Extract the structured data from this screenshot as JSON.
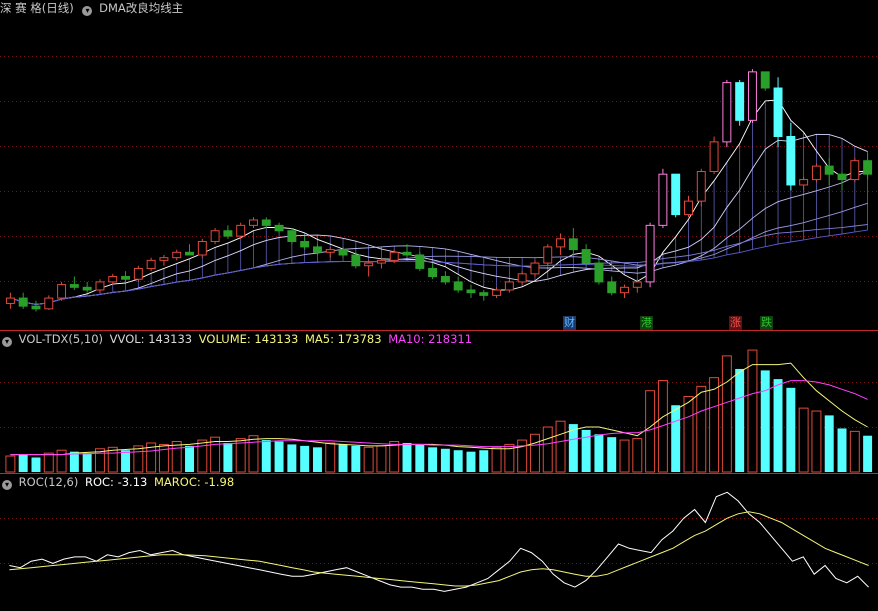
{
  "header": {
    "stock_name": "深 赛 格(日线)",
    "indicator_name": "DMA改良均线主",
    "icon": "chevron-down-icon"
  },
  "volume_header": {
    "indicator": "VOL-TDX(5,10)",
    "vvol_label": "VVOL: 143133",
    "volume_label": "VOLUME: 143133",
    "ma5_label": "MA5: 173783",
    "ma10_label": "MA10: 218311"
  },
  "roc_header": {
    "indicator": "ROC(12,6)",
    "roc_label": "ROC: -3.13",
    "maroc_label": "MAROC: -1.98"
  },
  "event_tags": [
    {
      "label": "财",
      "color": "#5fb8ff"
    },
    {
      "label": "港",
      "color": "#29c229"
    },
    {
      "label": "涨",
      "color": "#ff4a4a"
    },
    {
      "label": "跌",
      "color": "#29c229"
    }
  ],
  "colors": {
    "up": "#e04a3a",
    "down_green": "#2aa02a",
    "down_cyan": "#55ffff",
    "limit_up": "#ff7de0",
    "ma5": "#f5f578",
    "ma10": "#ff40ff",
    "roc": "#ffffff",
    "maroc": "#f5f578",
    "grid": "#7a1010",
    "band": "#6a6ac8"
  },
  "chart_data": [
    {
      "type": "candlestick",
      "title": "深 赛 格(日线)",
      "indicator": "DMA改良均线主",
      "candles": [
        [
          8.1,
          8.3,
          8.0,
          8.2
        ],
        [
          8.2,
          8.3,
          8.0,
          8.05
        ],
        [
          8.05,
          8.15,
          7.95,
          8.0
        ],
        [
          8.0,
          8.25,
          7.98,
          8.2
        ],
        [
          8.2,
          8.5,
          8.15,
          8.45
        ],
        [
          8.45,
          8.6,
          8.35,
          8.4
        ],
        [
          8.4,
          8.5,
          8.3,
          8.35
        ],
        [
          8.35,
          8.55,
          8.3,
          8.5
        ],
        [
          8.5,
          8.65,
          8.45,
          8.6
        ],
        [
          8.6,
          8.7,
          8.5,
          8.55
        ],
        [
          8.55,
          8.8,
          8.5,
          8.75
        ],
        [
          8.75,
          8.95,
          8.7,
          8.9
        ],
        [
          8.9,
          9.0,
          8.8,
          8.95
        ],
        [
          8.95,
          9.1,
          8.9,
          9.05
        ],
        [
          9.05,
          9.2,
          9.0,
          9.0
        ],
        [
          9.0,
          9.3,
          8.95,
          9.25
        ],
        [
          9.25,
          9.5,
          9.2,
          9.45
        ],
        [
          9.45,
          9.55,
          9.3,
          9.35
        ],
        [
          9.35,
          9.6,
          9.3,
          9.55
        ],
        [
          9.55,
          9.7,
          9.5,
          9.65
        ],
        [
          9.65,
          9.7,
          9.5,
          9.55
        ],
        [
          9.55,
          9.6,
          9.4,
          9.45
        ],
        [
          9.45,
          9.5,
          9.2,
          9.25
        ],
        [
          9.25,
          9.35,
          9.1,
          9.15
        ],
        [
          9.15,
          9.2,
          9.0,
          9.05
        ],
        [
          9.05,
          9.15,
          8.95,
          9.1
        ],
        [
          9.1,
          9.15,
          8.95,
          9.0
        ],
        [
          9.0,
          9.05,
          8.75,
          8.8
        ],
        [
          8.8,
          8.9,
          8.6,
          8.85
        ],
        [
          8.85,
          8.95,
          8.75,
          8.9
        ],
        [
          8.9,
          9.1,
          8.85,
          9.05
        ],
        [
          9.05,
          9.2,
          8.95,
          9.0
        ],
        [
          9.0,
          9.05,
          8.7,
          8.75
        ],
        [
          8.75,
          8.85,
          8.55,
          8.6
        ],
        [
          8.6,
          8.7,
          8.45,
          8.5
        ],
        [
          8.5,
          8.6,
          8.3,
          8.35
        ],
        [
          8.35,
          8.45,
          8.2,
          8.3
        ],
        [
          8.3,
          8.35,
          8.15,
          8.25
        ],
        [
          8.25,
          8.4,
          8.2,
          8.35
        ],
        [
          8.35,
          8.55,
          8.3,
          8.5
        ],
        [
          8.5,
          8.7,
          8.45,
          8.65
        ],
        [
          8.65,
          8.9,
          8.6,
          8.85
        ],
        [
          8.85,
          9.2,
          8.8,
          9.15
        ],
        [
          9.15,
          9.4,
          9.0,
          9.3
        ],
        [
          9.3,
          9.5,
          9.0,
          9.1
        ],
        [
          9.1,
          9.2,
          8.8,
          8.85
        ],
        [
          8.85,
          8.9,
          8.45,
          8.5
        ],
        [
          8.5,
          8.6,
          8.25,
          8.3
        ],
        [
          8.3,
          8.45,
          8.2,
          8.4
        ],
        [
          8.4,
          8.55,
          8.3,
          8.5
        ],
        [
          8.5,
          9.6,
          8.4,
          9.55
        ],
        [
          9.55,
          10.6,
          9.5,
          10.5
        ],
        [
          10.5,
          10.5,
          9.7,
          9.75
        ],
        [
          9.75,
          10.1,
          9.7,
          10.0
        ],
        [
          10.0,
          10.6,
          9.9,
          10.55
        ],
        [
          10.55,
          11.2,
          10.5,
          11.1
        ],
        [
          11.1,
          12.25,
          11.0,
          12.2
        ],
        [
          12.2,
          12.25,
          11.4,
          11.5
        ],
        [
          11.5,
          12.45,
          11.45,
          12.4
        ],
        [
          12.4,
          12.4,
          12.05,
          12.1
        ],
        [
          12.1,
          12.3,
          11.0,
          11.2
        ],
        [
          11.2,
          11.45,
          10.2,
          10.3
        ],
        [
          10.3,
          10.45,
          10.2,
          10.4
        ],
        [
          10.4,
          10.7,
          10.35,
          10.65
        ],
        [
          10.65,
          10.8,
          10.3,
          10.5
        ],
        [
          10.5,
          10.55,
          10.2,
          10.4
        ],
        [
          10.4,
          10.8,
          10.35,
          10.75
        ],
        [
          10.75,
          10.9,
          10.4,
          10.5
        ]
      ],
      "ylim": [
        7.7,
        13.4
      ]
    },
    {
      "type": "bar",
      "indicator": "VOL-TDX(5,10)",
      "values": [
        22,
        24,
        20,
        26,
        30,
        28,
        26,
        32,
        34,
        30,
        36,
        40,
        38,
        42,
        36,
        44,
        48,
        40,
        46,
        50,
        44,
        42,
        38,
        36,
        34,
        40,
        38,
        36,
        34,
        36,
        42,
        40,
        38,
        34,
        32,
        30,
        28,
        30,
        34,
        38,
        44,
        52,
        62,
        70,
        66,
        58,
        52,
        48,
        44,
        46,
        112,
        126,
        92,
        104,
        118,
        130,
        160,
        142,
        168,
        140,
        128,
        116,
        88,
        84,
        78,
        60,
        56,
        50
      ],
      "ma5": [
        24,
        24,
        24,
        24,
        24,
        26,
        27,
        28,
        30,
        31,
        32,
        34,
        36,
        37,
        38,
        40,
        42,
        42,
        43,
        45,
        46,
        46,
        45,
        43,
        41,
        39,
        38,
        37,
        36,
        36,
        37,
        38,
        38,
        38,
        37,
        35,
        34,
        33,
        32,
        32,
        35,
        40,
        46,
        52,
        58,
        62,
        62,
        58,
        54,
        50,
        62,
        76,
        86,
        96,
        110,
        114,
        124,
        138,
        148,
        148,
        148,
        150,
        130,
        112,
        98,
        84,
        72,
        62
      ],
      "ma10": [
        24,
        24,
        24,
        24,
        24,
        25,
        25,
        26,
        26,
        27,
        28,
        29,
        31,
        33,
        34,
        36,
        38,
        39,
        40,
        41,
        42,
        43,
        43,
        43,
        43,
        43,
        42,
        41,
        40,
        39,
        38,
        38,
        38,
        37,
        37,
        37,
        36,
        35,
        35,
        35,
        36,
        37,
        39,
        42,
        45,
        48,
        51,
        53,
        54,
        54,
        58,
        64,
        70,
        76,
        84,
        90,
        96,
        102,
        108,
        112,
        120,
        126,
        126,
        124,
        120,
        114,
        108,
        100
      ],
      "vvol_value": 143133,
      "ma5_value": 173783,
      "ma10_value": 218311
    },
    {
      "type": "line",
      "indicator": "ROC(12,6)",
      "series": [
        {
          "name": "ROC",
          "values": [
            2,
            1,
            4,
            5,
            3,
            5,
            6,
            6,
            4,
            7,
            6,
            8,
            9,
            7,
            8,
            9,
            7,
            6,
            5,
            4,
            3,
            2,
            1,
            0,
            -1,
            -2,
            -3,
            -3,
            -2,
            -1,
            0,
            1,
            -1,
            -3,
            -5,
            -7,
            -8,
            -8,
            -9,
            -9,
            -10,
            -9,
            -8,
            -6,
            -4,
            0,
            4,
            10,
            8,
            4,
            -2,
            -6,
            -8,
            -5,
            0,
            6,
            12,
            10,
            9,
            8,
            14,
            18,
            24,
            28,
            22,
            34,
            36,
            32,
            26,
            22,
            16,
            10,
            4,
            6,
            -2,
            2,
            -4,
            -6,
            -3,
            -8
          ]
        },
        {
          "name": "MAROC",
          "values": [
            0,
            0.5,
            1,
            1.5,
            2,
            2.5,
            3,
            3.5,
            4,
            4.5,
            5,
            5.5,
            6,
            6.5,
            7,
            7,
            7,
            6.8,
            6.5,
            6,
            5.5,
            5,
            4.5,
            4,
            3,
            2,
            1,
            0,
            -1,
            -1.5,
            -2,
            -2.5,
            -3,
            -3.5,
            -4,
            -4.5,
            -5,
            -5.5,
            -6,
            -6.5,
            -7,
            -7.5,
            -7.5,
            -7,
            -6,
            -5,
            -3,
            -1,
            0,
            0.5,
            0,
            -1,
            -2,
            -3,
            -3,
            -2,
            0,
            2,
            4,
            6,
            8,
            10,
            13,
            16,
            18,
            21,
            24,
            26,
            27,
            26,
            24,
            22,
            19,
            16,
            13,
            10,
            8,
            6,
            4,
            2
          ]
        }
      ],
      "roc_value": -3.13,
      "maroc_value": -1.98
    }
  ]
}
